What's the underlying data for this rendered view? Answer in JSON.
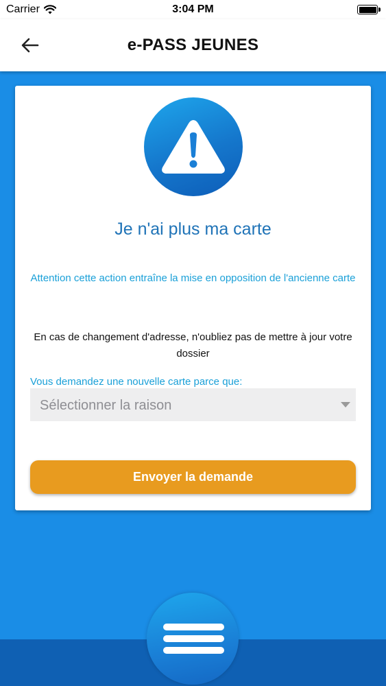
{
  "status_bar": {
    "carrier": "Carrier",
    "time": "3:04 PM",
    "icons": [
      "wifi-icon",
      "battery-icon"
    ]
  },
  "header": {
    "title": "e-PASS JEUNES",
    "back_icon": "arrow-left-icon"
  },
  "card": {
    "icon": "warning-icon",
    "title": "Je n'ai plus ma carte",
    "warning": "Attention cette action entraîne la mise en opposition de l'ancienne carte",
    "info": "En cas de changement d'adresse, n'oubliez pas de mettre à jour votre dossier",
    "select_label": "Vous demandez une nouvelle carte parce que:",
    "select_value": "Sélectionner la raison",
    "submit_label": "Envoyer la demande"
  },
  "bottom": {
    "menu_icon": "hamburger-menu-icon"
  },
  "colors": {
    "background": "#1a8de6",
    "accent_blue": "#1f73b7",
    "link_blue": "#1aa0d8",
    "button_orange": "#e89b1f",
    "bottom_bar": "#0f60b3"
  }
}
